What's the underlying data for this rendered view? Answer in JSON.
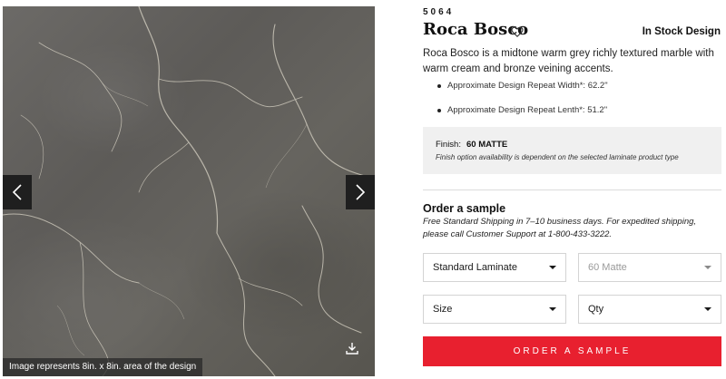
{
  "gallery": {
    "caption": "Image represents 8in. x 8in. area of the design",
    "prev_icon": "chevron-left-icon",
    "next_icon": "chevron-right-icon",
    "download_icon": "download-icon"
  },
  "product": {
    "sku": "5064",
    "title": "Roca Bosco",
    "favorite_icon": "heart-icon",
    "stock_status": "In Stock Design",
    "description": "Roca Bosco is a midtone warm grey richly textured marble with warm cream and bronze veining accents.",
    "specs": [
      "Approximate Design Repeat Width*: 62.2\"",
      "Approximate Design Repeat Lenth*: 51.2\""
    ]
  },
  "finish": {
    "label": "Finish:",
    "value": "60 MATTE",
    "note": "Finish option availability is dependent on the selected laminate product type"
  },
  "order": {
    "title": "Order a sample",
    "note": "Free Standard Shipping in 7–10 business days. For expedited shipping, please call Customer Support at 1-800-433-3222.",
    "selects": {
      "laminate": "Standard Laminate",
      "finish": "60 Matte",
      "size": "Size",
      "qty": "Qty"
    },
    "button_label": "ORDER A SAMPLE"
  },
  "colors": {
    "accent": "#e8202f",
    "marble_base": "#64625e",
    "nav_bg": "#1f1f1f",
    "finish_bg": "#f0f0f0"
  }
}
